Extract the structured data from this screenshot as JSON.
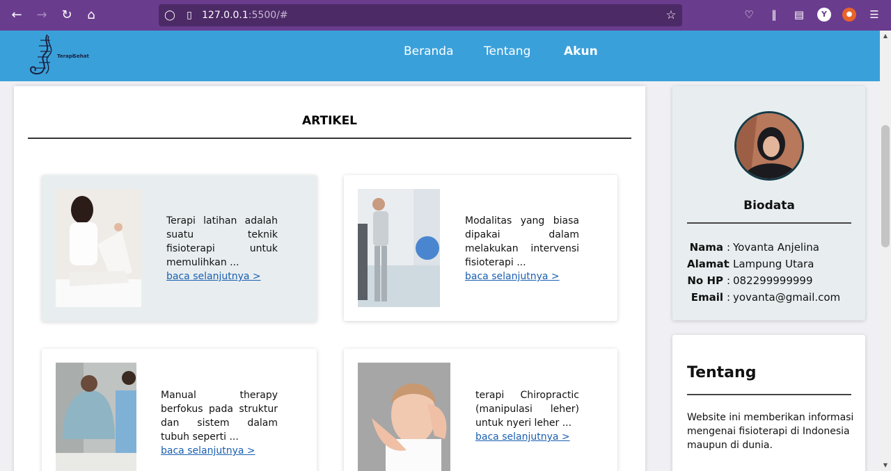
{
  "browser": {
    "url_host": "127.0.0.1",
    "url_path": ":5500/#"
  },
  "site": {
    "logo_text_1": "Terapi",
    "logo_text_2": "Sehat",
    "nav": [
      {
        "label": "Beranda"
      },
      {
        "label": "Tentang"
      },
      {
        "label": "Akun"
      }
    ]
  },
  "articles": {
    "heading": "ARTIKEL",
    "items": [
      {
        "text": "Terapi latihan adalah suatu teknik fisioterapi untuk memulihkan ...",
        "link": "baca selanjutnya >"
      },
      {
        "text": "Modalitas yang biasa dipakai dalam melakukan intervensi fisioterapi ...",
        "link": "baca selanjutnya >"
      },
      {
        "text": "Manual therapy berfokus pada struktur dan sistem dalam tubuh seperti ...",
        "link": "baca selanjutnya >"
      },
      {
        "text": "terapi Chiropractic (manipulasi leher) untuk nyeri leher ...",
        "link": "baca selanjutnya >"
      }
    ]
  },
  "biodata": {
    "title": "Biodata",
    "rows": [
      {
        "key": "Nama",
        "value": "Yovanta Anjelina"
      },
      {
        "key": "Alamat",
        "value": "Lampung Utara"
      },
      {
        "key": "No HP",
        "value": "082299999999"
      },
      {
        "key": "Email",
        "value": "yovanta@gmail.com"
      }
    ]
  },
  "about": {
    "title": "Tentang",
    "text": "Website ini memberikan informasi mengenai fisioterapi di Indonesia maupun di dunia."
  },
  "colors": {
    "browser_bar": "#6a3c8e",
    "header": "#3aa0da",
    "link": "#1a5fb0",
    "card_tint": "#e8eef0"
  }
}
